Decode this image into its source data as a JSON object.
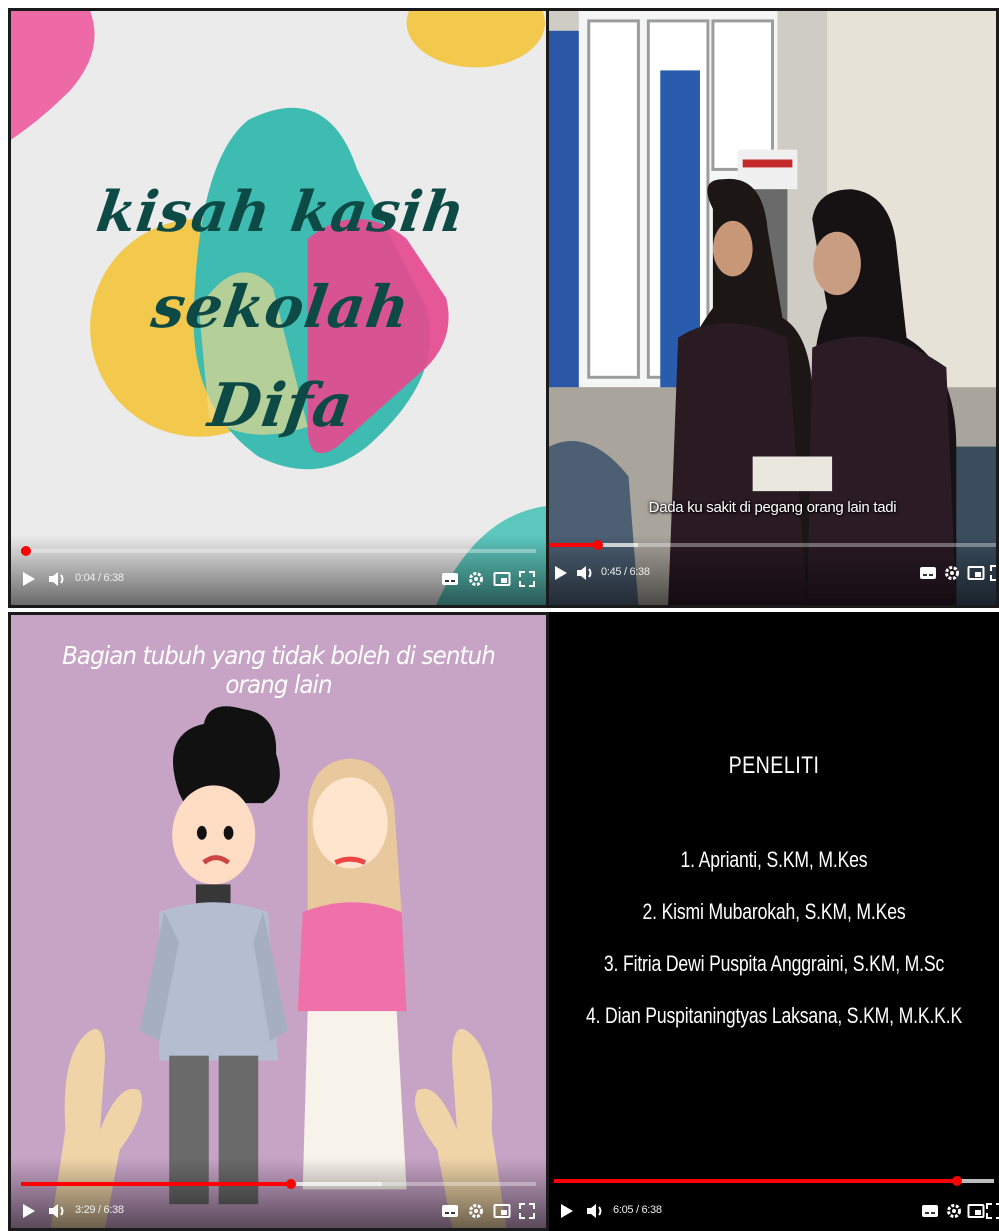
{
  "videos": [
    {
      "title_lines": [
        "kisah kasih",
        "sekolah",
        "Difa"
      ],
      "time": "0:04 / 6:38",
      "progress": 0.01,
      "buffered": 0.0
    },
    {
      "subtitle": "Dada ku sakit di pegang orang lain tadi",
      "time": "0:45 / 6:38",
      "progress": 0.11,
      "buffered": 0.2
    },
    {
      "heading": "Bagian tubuh yang tidak boleh di sentuh orang lain",
      "time": "3:29 / 6:38",
      "progress": 0.525,
      "buffered": 0.7
    },
    {
      "credits_title": "PENELITI",
      "credits": [
        "1. Aprianti, S.KM, M.Kes",
        "2. Kismi Mubarokah, S.KM, M.Kes",
        "3. Fitria Dewi Puspita Anggraini, S.KM, M.Sc",
        "4. Dian Puspitaningtyas Laksana, S.KM, M.K.K.K"
      ],
      "time": "6:05 / 6:38",
      "progress": 0.915,
      "buffered": 1.0
    }
  ],
  "controls": {
    "play_icon": "play-icon",
    "volume_icon": "volume-icon",
    "captions_icon": "captions-icon",
    "settings_icon": "gear-icon",
    "miniplayer_icon": "miniplayer-icon",
    "fullscreen_icon": "fullscreen-icon"
  },
  "colors": {
    "progress_played": "#ff0000",
    "title_text": "#0d4a45",
    "panel3_bg": "#c7a3c6"
  }
}
